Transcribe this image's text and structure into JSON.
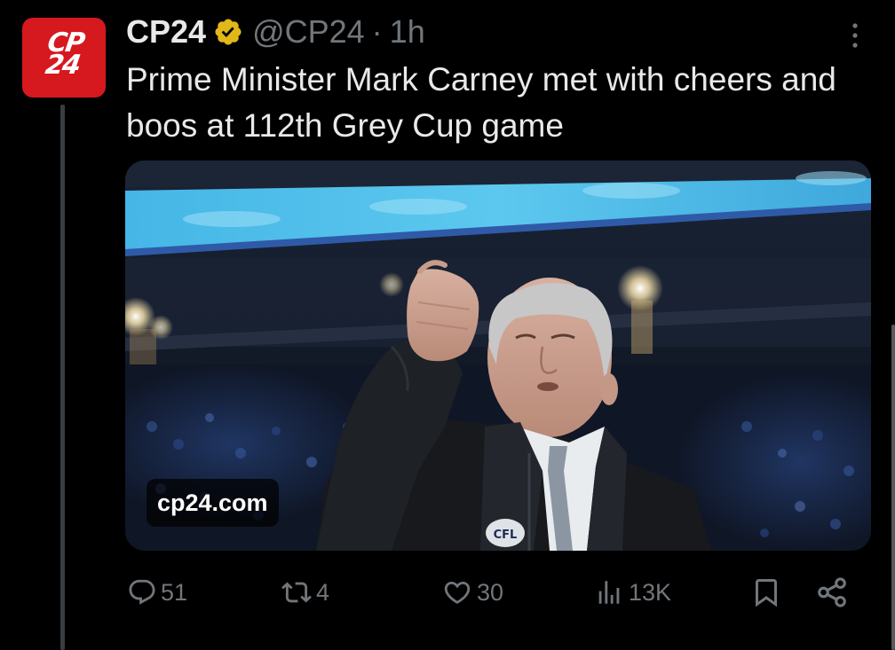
{
  "account": {
    "avatar_text_top": "CP",
    "avatar_text_bottom": "24",
    "display_name": "CP24",
    "handle": "@CP24",
    "separator": "·",
    "time": "1h",
    "avatar_color": "#d6181f",
    "verified_color": "#e2b719"
  },
  "tweet": {
    "text": "Prime Minister Mark Carney met with cheers and boos at 112th Grey Cup game"
  },
  "media": {
    "link_label": "cp24.com",
    "jacket_patch": "CFL"
  },
  "actions": {
    "reply_count": "51",
    "repost_count": "4",
    "like_count": "30",
    "views_count": "13K"
  },
  "icons": {
    "verified": "verified-badge-icon",
    "more": "more-icon",
    "reply": "reply-icon",
    "repost": "repost-icon",
    "like": "heart-icon",
    "views": "views-icon",
    "bookmark": "bookmark-icon",
    "share": "share-icon"
  },
  "colors": {
    "background": "#000000",
    "text_primary": "#e7e9ea",
    "text_secondary": "#71767b"
  }
}
